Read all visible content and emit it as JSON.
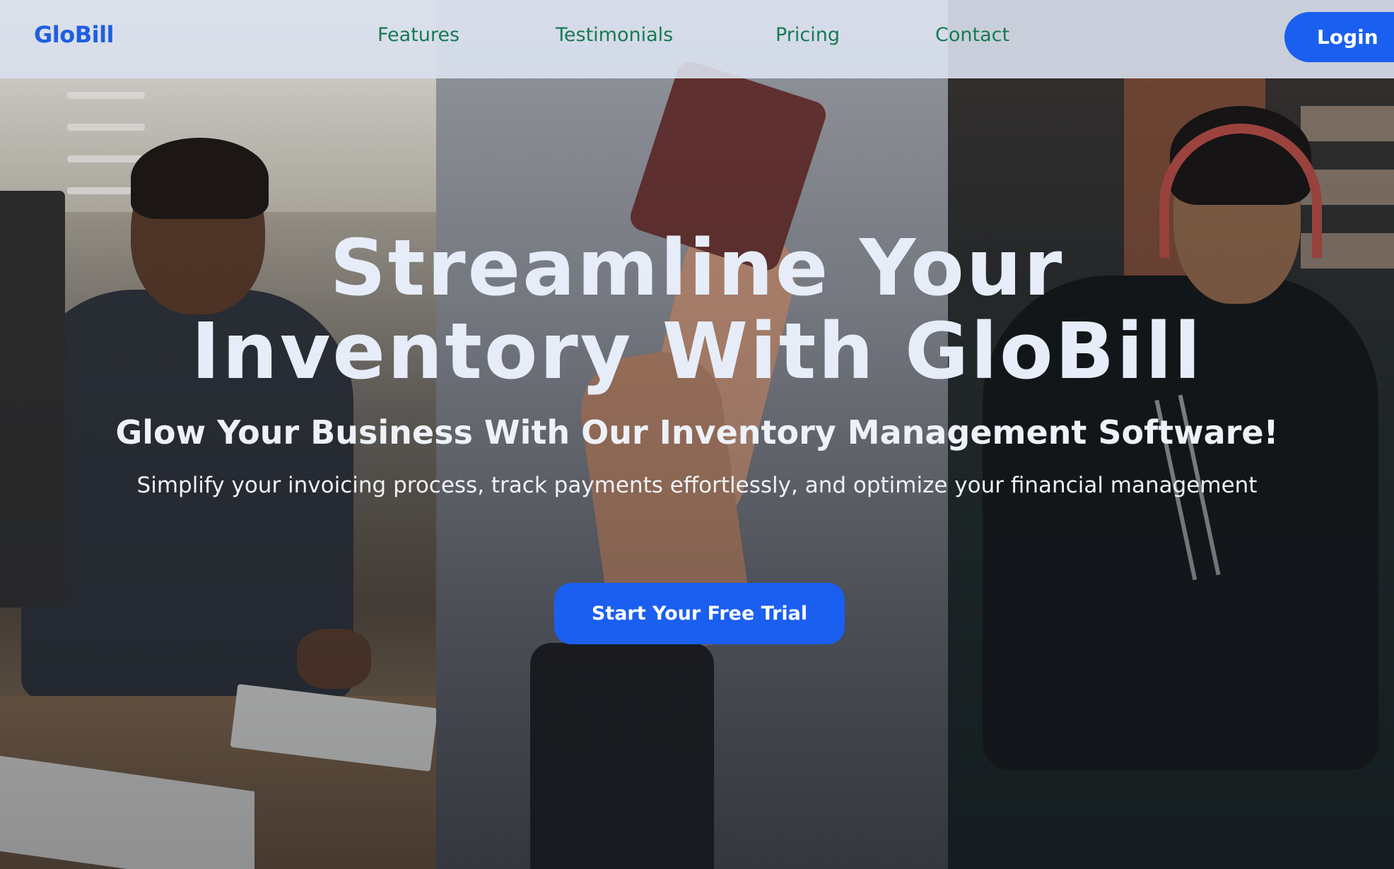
{
  "navbar": {
    "brand": "GloBill",
    "links": [
      {
        "label": "Features"
      },
      {
        "label": "Testimonials"
      },
      {
        "label": "Pricing"
      },
      {
        "label": "Contact"
      }
    ],
    "login_label": "Login"
  },
  "hero": {
    "headline_line1": "Streamline Your",
    "headline_line2": "Inventory With GloBill",
    "subheadline": "Glow Your Business With Our Inventory Management Software!",
    "description": "Simplify your invoicing process, track payments effortlessly, and optimize your financial management",
    "cta_label": "Start Your Free Trial"
  },
  "colors": {
    "brand_blue": "#1f5fe0",
    "button_blue": "#1a5fef",
    "nav_link_green": "#177a55",
    "navbar_bg": "#dee5f3",
    "headline_text": "#e6edf9"
  }
}
